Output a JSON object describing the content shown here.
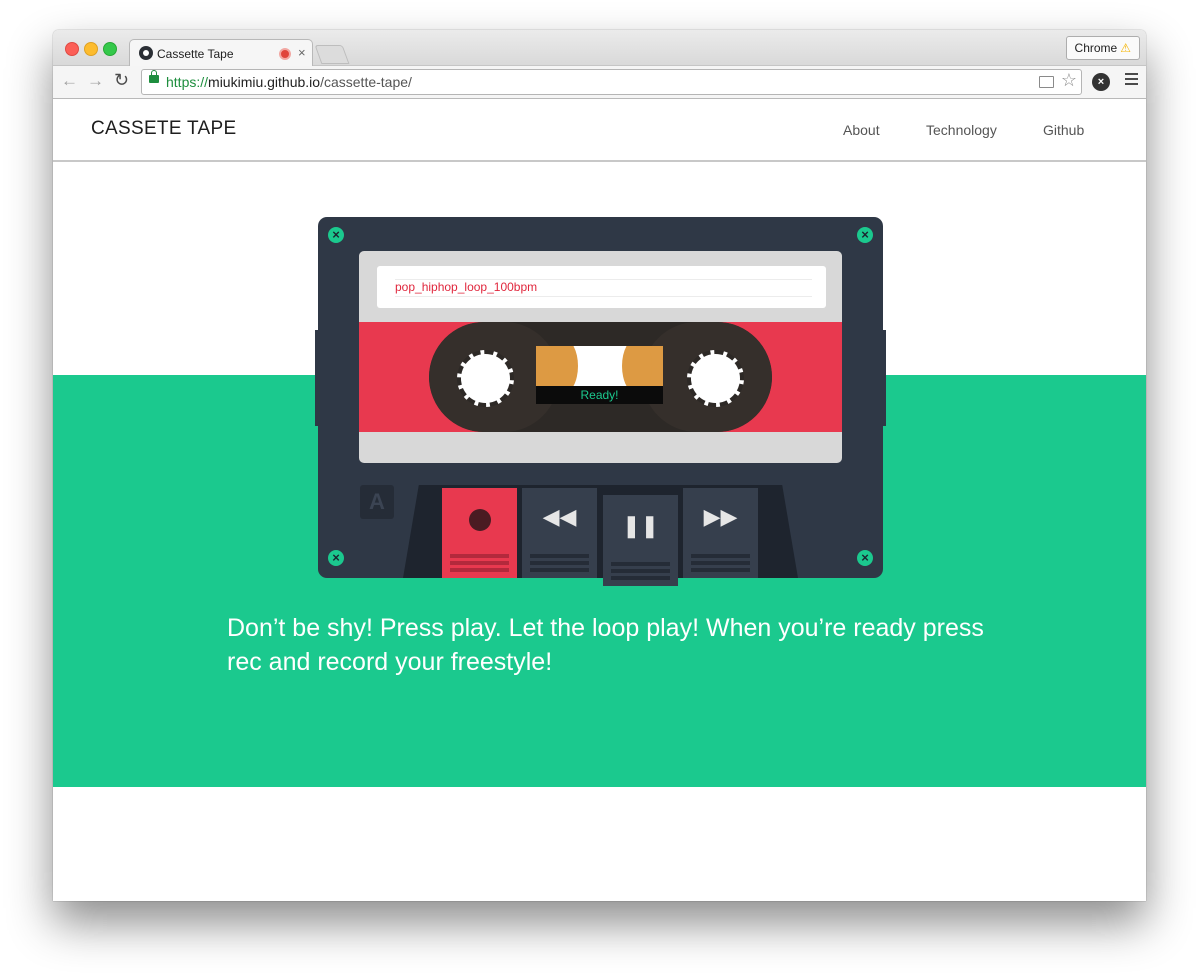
{
  "browser": {
    "tab": {
      "title": "Cassette Tape",
      "close_icon": "×"
    },
    "profile_button": {
      "label": "Chrome",
      "warning_icon": "⚠"
    },
    "url": {
      "scheme": "https://",
      "host": "miukimiu.github.io",
      "path": "/cassette-tape/"
    }
  },
  "site": {
    "brand": "CASSETE TAPE",
    "nav": {
      "about": "About",
      "technology": "Technology",
      "github": "Github"
    }
  },
  "cassette": {
    "label": "pop_hiphop_loop_100bpm",
    "status": "Ready!",
    "side": "A",
    "screw_glyph": "×",
    "controls": {
      "rewind_icon": "◀◀",
      "pause_icon": "❚❚",
      "fast_forward_icon": "▶▶"
    }
  },
  "hero": {
    "text": "Don’t be shy! Press play. Let the loop play! When you’re ready press rec and record your freestyle!"
  },
  "colors": {
    "accent_green": "#1bc98e",
    "cassette_body": "#2f3846",
    "cassette_red": "#e8394f",
    "tape_orange": "#dd9a43"
  }
}
